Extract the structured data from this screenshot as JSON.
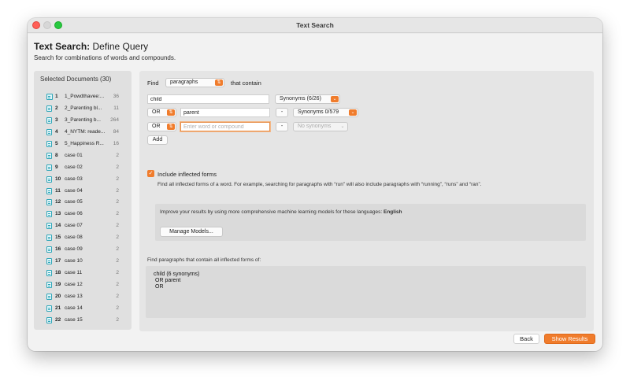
{
  "window": {
    "title": "Text Search"
  },
  "header": {
    "title_bold": "Text Search:",
    "title_rest": "Define Query",
    "subtitle": "Search for combinations of words and compounds."
  },
  "sidebar": {
    "title": "Selected Documents (30)",
    "documents": [
      {
        "num": "1",
        "name": "1_Powdthavee:...",
        "count": "36",
        "icon": "media-doc-icon"
      },
      {
        "num": "2",
        "name": "2_Parenting bl...",
        "count": "11",
        "icon": "text-doc-icon"
      },
      {
        "num": "3",
        "name": "3_Parenting b...",
        "count": "264",
        "icon": "text-doc-icon"
      },
      {
        "num": "4",
        "name": "4_NYTM: reade...",
        "count": "84",
        "icon": "text-doc-icon"
      },
      {
        "num": "5",
        "name": "5_Happiness R...",
        "count": "16",
        "icon": "text-doc-icon"
      },
      {
        "num": "8",
        "name": "case 01",
        "count": "2",
        "icon": "text-doc-icon"
      },
      {
        "num": "9",
        "name": "case 02",
        "count": "2",
        "icon": "text-doc-icon"
      },
      {
        "num": "10",
        "name": "case 03",
        "count": "2",
        "icon": "text-doc-icon"
      },
      {
        "num": "11",
        "name": "case 04",
        "count": "2",
        "icon": "text-doc-icon"
      },
      {
        "num": "12",
        "name": "case 05",
        "count": "2",
        "icon": "text-doc-icon"
      },
      {
        "num": "13",
        "name": "case 06",
        "count": "2",
        "icon": "text-doc-icon"
      },
      {
        "num": "14",
        "name": "case 07",
        "count": "2",
        "icon": "text-doc-icon"
      },
      {
        "num": "15",
        "name": "case 08",
        "count": "2",
        "icon": "text-doc-icon"
      },
      {
        "num": "16",
        "name": "case 09",
        "count": "2",
        "icon": "text-doc-icon"
      },
      {
        "num": "17",
        "name": "case 10",
        "count": "2",
        "icon": "text-doc-icon"
      },
      {
        "num": "18",
        "name": "case 11",
        "count": "2",
        "icon": "text-doc-icon"
      },
      {
        "num": "19",
        "name": "case 12",
        "count": "2",
        "icon": "text-doc-icon"
      },
      {
        "num": "20",
        "name": "case 13",
        "count": "2",
        "icon": "text-doc-icon"
      },
      {
        "num": "21",
        "name": "case 14",
        "count": "2",
        "icon": "text-doc-icon"
      },
      {
        "num": "22",
        "name": "case 15",
        "count": "2",
        "icon": "text-doc-icon"
      }
    ]
  },
  "query": {
    "find_label": "Find",
    "unit_selected": "paragraphs",
    "contain_label": "that contain",
    "rows": [
      {
        "operator": "",
        "term": "child",
        "placeholder": "",
        "synonyms": "Synonyms (6/26)"
      },
      {
        "operator": "OR",
        "term": "parent",
        "placeholder": "",
        "synonyms": "Synonyms 0/579"
      },
      {
        "operator": "OR",
        "term": "",
        "placeholder": "Enter word or compound",
        "synonyms": "No synonyms"
      }
    ],
    "remove_label": "-",
    "add_label": "Add"
  },
  "inflected": {
    "label": "Include inflected forms",
    "checked": true,
    "description": "Find all inflected forms of a word. For example, searching for paragraphs with “run” will also include paragraphs with “running”, “runs” and “ran”."
  },
  "models": {
    "text": "Improve your results by using more comprehensive machine learning models for these languages:",
    "languages": "English",
    "button": "Manage Models..."
  },
  "summary": {
    "label": "Find paragraphs that contain all inflected forms of:",
    "lines": [
      "child (6 synonyms)",
      "OR parent",
      "OR"
    ]
  },
  "footer": {
    "back": "Back",
    "show": "Show Results"
  },
  "colors": {
    "accent": "#f07c2c",
    "doc_icon": "#30a6b8"
  }
}
